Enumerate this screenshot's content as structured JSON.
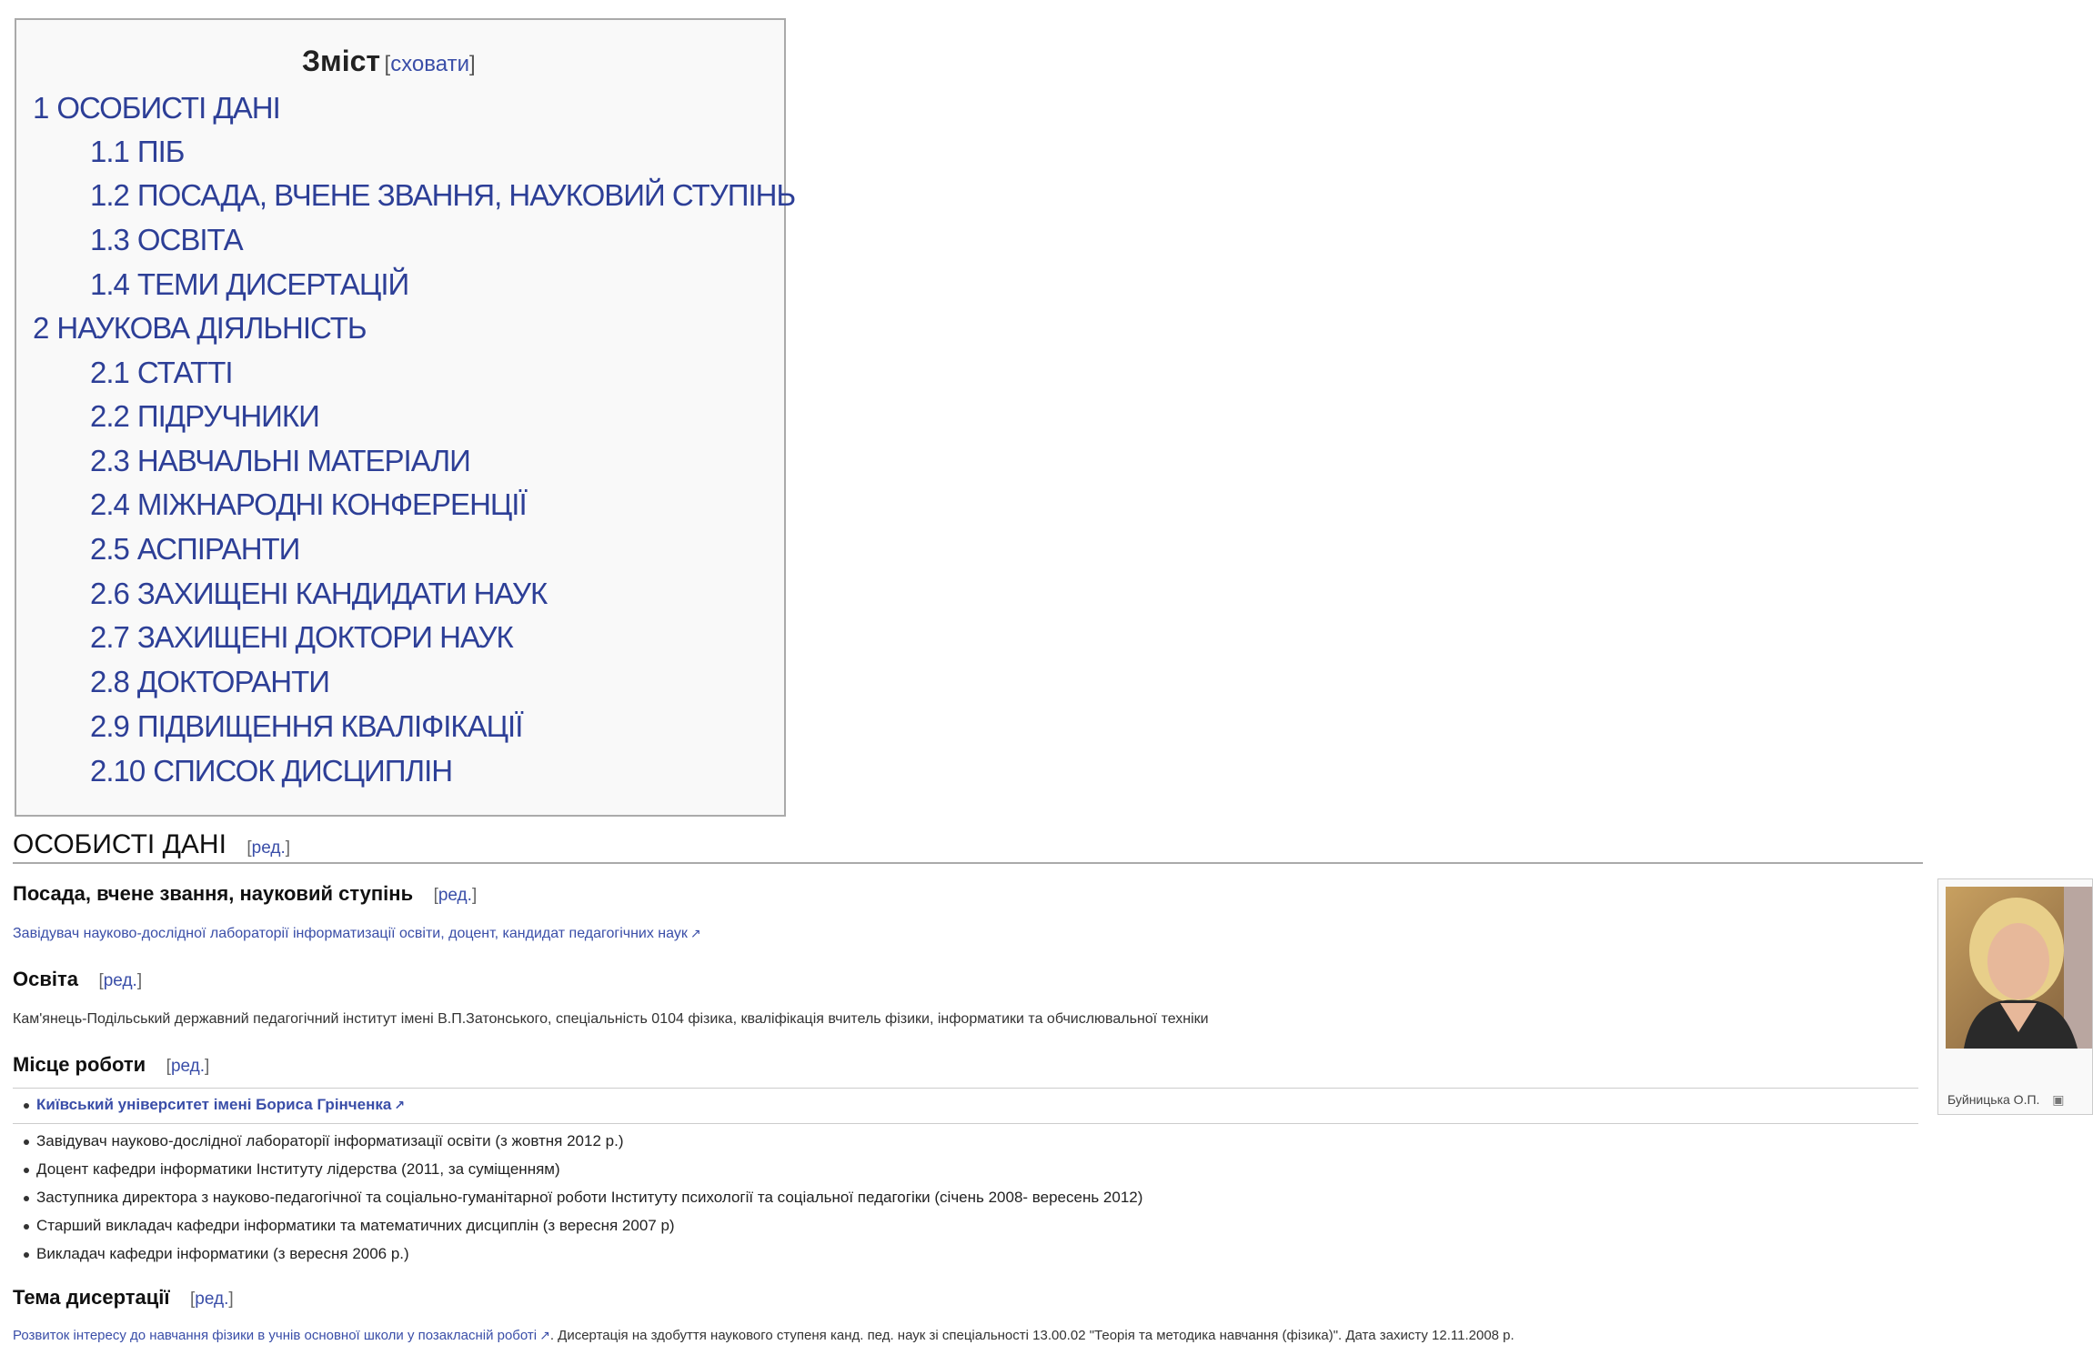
{
  "toc": {
    "title": "Зміст",
    "hide_label": "сховати",
    "items": [
      {
        "num": "1",
        "label": "ОСОБИСТІ ДАНІ"
      },
      {
        "num": "1.1",
        "label": "ПІБ"
      },
      {
        "num": "1.2",
        "label": "ПОСАДА, ВЧЕНЕ ЗВАННЯ, НАУКОВИЙ СТУПІНЬ"
      },
      {
        "num": "1.3",
        "label": "ОСВІТА"
      },
      {
        "num": "1.4",
        "label": "ТЕМИ ДИСЕРТАЦІЙ"
      },
      {
        "num": "2",
        "label": "НАУКОВА ДІЯЛЬНІСТЬ"
      },
      {
        "num": "2.1",
        "label": "СТАТТІ"
      },
      {
        "num": "2.2",
        "label": "ПІДРУЧНИКИ"
      },
      {
        "num": "2.3",
        "label": "НАВЧАЛЬНІ МАТЕРІАЛИ"
      },
      {
        "num": "2.4",
        "label": "МІЖНАРОДНІ КОНФЕРЕНЦІЇ"
      },
      {
        "num": "2.5",
        "label": "АСПІРАНТИ"
      },
      {
        "num": "2.6",
        "label": "ЗАХИЩЕНІ КАНДИДАТИ НАУК"
      },
      {
        "num": "2.7",
        "label": "ЗАХИЩЕНІ ДОКТОРИ НАУК"
      },
      {
        "num": "2.8",
        "label": "ДОКТОРАНТИ"
      },
      {
        "num": "2.9",
        "label": "ПІДВИЩЕННЯ КВАЛІФІКАЦІЇ"
      },
      {
        "num": "2.10",
        "label": "СПИСОК ДИСЦИПЛІН"
      }
    ]
  },
  "edit_label": "ред.",
  "personal": {
    "heading": "ОСОБИСТІ ДАНІ"
  },
  "position": {
    "heading": "Посада, вчене звання, науковий ступінь",
    "text": "Завідувач науково-дослідної лабораторії інформатизації освіти, доцент, кандидат педагогічних наук"
  },
  "education": {
    "heading": "Освіта",
    "text": "Кам'янець-Подільський державний педагогічний інститут імені В.П.Затонського, спеціальність 0104 фізика, кваліфікація вчитель фізики, інформатики та обчислювальної техніки"
  },
  "work": {
    "heading": "Місце роботи",
    "university": "Київський університет імені Бориса Грінченка",
    "items": [
      "Завідувач науково-дослідної лабораторії інформатизації освіти (з жовтня 2012 р.)",
      "Доцент кафедри інформатики Інституту лідерства (2011, за суміщенням)",
      "Заступника директора з науково-педагогічної та соціально-гуманітарної роботи Інституту психології та соціальної педагогіки (січень 2008- вересень 2012)",
      "Старший викладач кафедри інформатики та математичних дисциплін (з вересня 2007 р)",
      "Викладач кафедри інформатики (з вересня 2006 р.)"
    ]
  },
  "dissertation": {
    "heading": "Тема дисертації",
    "link": "Розвиток інтересу до навчання фізики в учнів основної школи у позакласній роботі",
    "text": ". Дисертація на здобуття наукового ступеня канд. пед. наук зі спеціальності 13.00.02 \"Теорія та методика навчання (фізика)\". Дата захисту 12.11.2008 р."
  },
  "photo": {
    "caption": "Буйницька О.П.",
    "icon": "enlarge-icon"
  },
  "colors": {
    "link": "#3a4ea8",
    "toc_bg": "#f9f9f9",
    "border": "#aaaaaa"
  }
}
